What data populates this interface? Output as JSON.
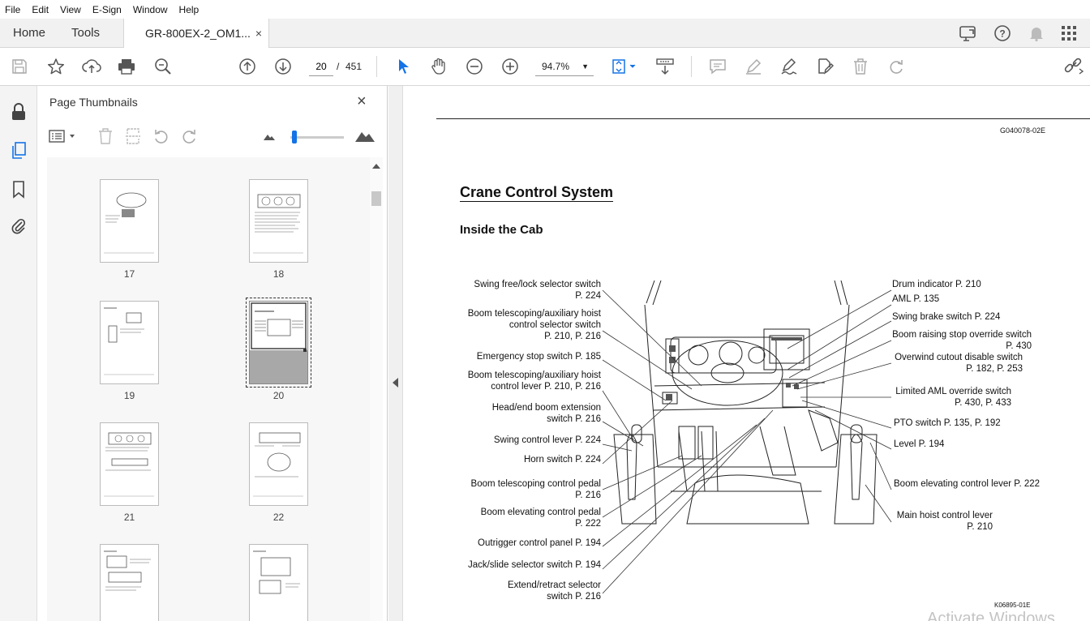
{
  "menu": [
    "File",
    "Edit",
    "View",
    "E-Sign",
    "Window",
    "Help"
  ],
  "tabs": {
    "home": "Home",
    "tools": "Tools",
    "document": "GR-800EX-2_OM1...",
    "close": "×"
  },
  "toolbar": {
    "page_current": "20",
    "page_sep": "/",
    "page_total": "451",
    "zoom": "94.7%"
  },
  "panel": {
    "title": "Page Thumbnails",
    "close": "×"
  },
  "thumbnails": [
    "17",
    "18",
    "19",
    "20",
    "21",
    "22",
    "",
    ""
  ],
  "document": {
    "code_top": "G040078-02E",
    "title": "Crane Control System",
    "subtitle": "Inside the Cab",
    "figure_code": "K06895-01E",
    "left_labels": [
      [
        "Swing free/lock selector switch",
        "P. 224"
      ],
      [
        "Boom telescoping/auxiliary hoist",
        "control selector switch",
        "P. 210, P. 216"
      ],
      [
        "Emergency stop switch P. 185"
      ],
      [
        "Boom telescoping/auxiliary hoist",
        "control lever P. 210, P. 216"
      ],
      [
        "Head/end boom extension",
        "switch P. 216"
      ],
      [
        "Swing control lever P. 224"
      ],
      [
        "Horn switch P. 224"
      ],
      [
        "Boom telescoping control pedal",
        "P. 216"
      ],
      [
        "Boom elevating control pedal",
        "P. 222"
      ],
      [
        "Outrigger control panel P. 194"
      ],
      [
        "Jack/slide selector switch P. 194"
      ],
      [
        "Extend/retract selector",
        "switch P. 216"
      ]
    ],
    "right_labels": [
      [
        "Drum indicator P. 210"
      ],
      [
        "AML P. 135"
      ],
      [
        "Swing brake switch P. 224"
      ],
      [
        "Boom raising stop override switch",
        "P. 430"
      ],
      [
        "Overwind cutout disable switch",
        "P. 182, P. 253"
      ],
      [
        "Limited AML override switch",
        "P. 430, P. 433"
      ],
      [
        "PTO switch P. 135, P. 192"
      ],
      [
        "Level P. 194"
      ],
      [
        "Boom elevating control lever P. 222"
      ],
      [
        "Main hoist control lever",
        "P. 210"
      ]
    ],
    "watermark": "Activate Windows"
  }
}
